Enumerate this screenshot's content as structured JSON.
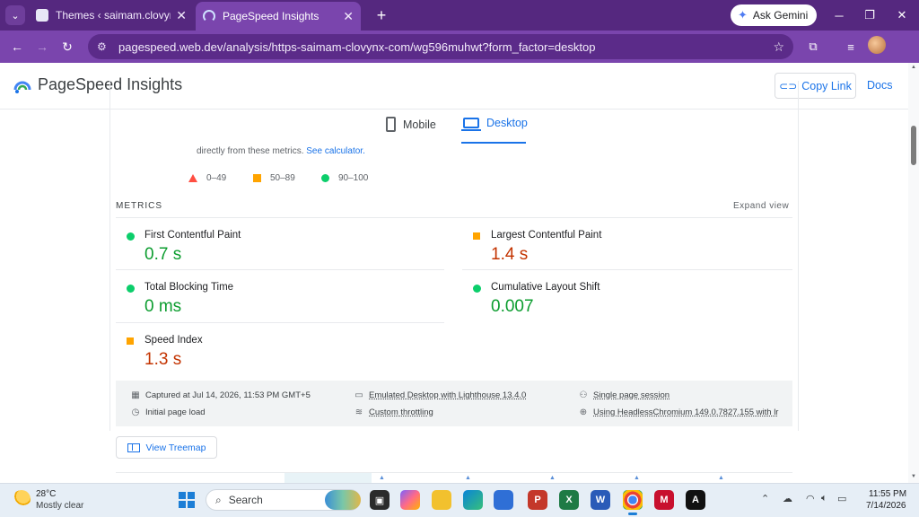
{
  "browser": {
    "tabs": [
      {
        "title": "Themes ‹ saimam.clovynx.com",
        "active": false
      },
      {
        "title": "PageSpeed Insights",
        "active": true
      }
    ],
    "gemini_label": "Ask Gemini",
    "url": "pagespeed.web.dev/analysis/https-saimam-clovynx-com/wg596muhwt?form_factor=desktop"
  },
  "psi": {
    "title": "PageSpeed Insights",
    "copy_link": "Copy Link",
    "docs": "Docs",
    "partial_text": "... .. .. ... . .. . ..",
    "form_factors": {
      "mobile": "Mobile",
      "desktop": "Desktop",
      "selected": "Desktop"
    },
    "calc_text": "directly from these metrics.",
    "calc_link": "See calculator.",
    "legend": [
      {
        "range": "0–49",
        "shape": "triangle",
        "color": "#ff4e42"
      },
      {
        "range": "50–89",
        "shape": "square",
        "color": "#ffa400"
      },
      {
        "range": "90–100",
        "shape": "circle",
        "color": "#0cce6b"
      }
    ],
    "metrics_title": "METRICS",
    "expand_view": "Expand view",
    "metrics": [
      {
        "name": "First Contentful Paint",
        "value": "0.7 s",
        "rating": "good"
      },
      {
        "name": "Largest Contentful Paint",
        "value": "1.4 s",
        "rating": "average"
      },
      {
        "name": "Total Blocking Time",
        "value": "0 ms",
        "rating": "good"
      },
      {
        "name": "Cumulative Layout Shift",
        "value": "0.007",
        "rating": "good"
      },
      {
        "name": "Speed Index",
        "value": "1.3 s",
        "rating": "average"
      }
    ],
    "run_info": {
      "captured": "Captured at Jul 14, 2026, 11:53 PM GMT+5",
      "page_load": "Initial page load",
      "emulated": "Emulated Desktop with Lighthouse 13.4.0",
      "throttling": "Custom throttling",
      "session": "Single page session",
      "browser": "Using HeadlessChromium 149.0.7827.155 with lr"
    },
    "view_treemap": "View Treemap"
  },
  "taskbar": {
    "temp": "28°C",
    "weather": "Mostly clear",
    "search_placeholder": "Search",
    "time": "11:55 PM",
    "date": "7/14/2026"
  },
  "colors": {
    "chrome_frame": "#55287f",
    "chrome_toolbar": "#7a45ad",
    "link_blue": "#1a73e8",
    "good": "#0c9d2f",
    "average": "#c33300"
  }
}
